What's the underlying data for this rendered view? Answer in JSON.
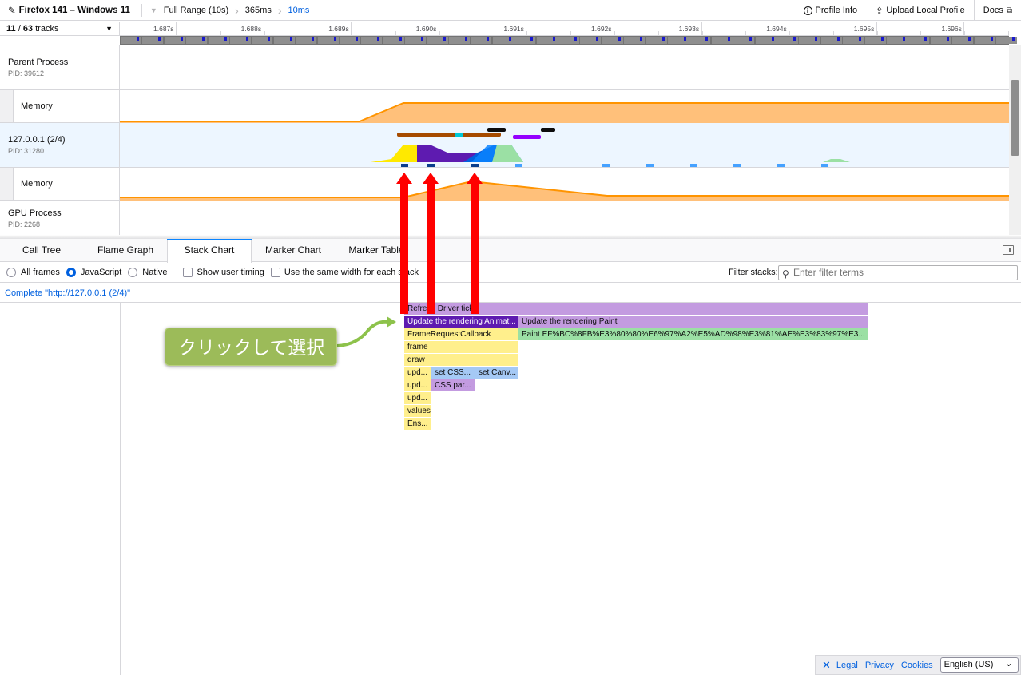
{
  "topbar": {
    "title": "Firefox 141 – Windows 11",
    "breadcrumbs": [
      "Full Range (10s)",
      "365ms",
      "10ms"
    ],
    "profile_info": "Profile Info",
    "upload": "Upload Local Profile",
    "docs": "Docs"
  },
  "timeline": {
    "track_count_visible": "11",
    "track_count_total": "63",
    "track_count_suffix": "tracks",
    "ticks": [
      "1.687s",
      "1.688s",
      "1.689s",
      "1.690s",
      "1.691s",
      "1.692s",
      "1.693s",
      "1.694s",
      "1.695s",
      "1.696s"
    ],
    "tracks": [
      {
        "name": "Parent Process",
        "pid": "PID: 39612"
      },
      {
        "name": "Memory"
      },
      {
        "name": "127.0.0.1 (2/4)",
        "pid": "PID: 31280"
      },
      {
        "name": "Memory"
      },
      {
        "name": "GPU Process",
        "pid": "PID: 2268"
      }
    ]
  },
  "tabs": [
    "Call Tree",
    "Flame Graph",
    "Stack Chart",
    "Marker Chart",
    "Marker Table"
  ],
  "selected_tab": "Stack Chart",
  "settings": {
    "all_frames": "All frames",
    "javascript": "JavaScript",
    "native": "Native",
    "show_user_timing": "Show user timing",
    "same_width": "Use the same width for each stack",
    "filter_label": "Filter stacks:",
    "filter_placeholder": "Enter filter terms"
  },
  "breadcrumb": "Complete \"http://127.0.0.1 (2/4)\"",
  "stack": {
    "refresh": "Refresh Driver tick",
    "update_anim": "Update the rendering Animat...",
    "update_paint": "Update the rendering Paint",
    "frame_request": "FrameRequestCallback",
    "paint_url": "Paint EF%BC%8FB%E3%80%80%E6%97%A2%E5%AD%98%E3%81%AE%E3%83%97%E3...",
    "frame": "frame",
    "draw": "draw",
    "upd1": "upd...",
    "set_css": "set CSS...",
    "set_canv": "set Canv...",
    "upd2": "upd...",
    "css_par": "CSS par...",
    "upd3": "upd...",
    "values": "values",
    "ens": "Ens..."
  },
  "annotation": "クリックして選択",
  "footer": {
    "legal": "Legal",
    "privacy": "Privacy",
    "cookies": "Cookies",
    "language": "English (US)"
  },
  "colors": {
    "accent": "#0a84ff",
    "memory_fill": "#ffc07a",
    "memory_line": "#ff9400",
    "js_yellow": "#ffef8c",
    "anim_purple": "#5e1bb0",
    "paint_purple": "#c39be0",
    "paint_green": "#9be0a4",
    "css_blue": "#a5c9f5",
    "arrow_red": "#ff0000",
    "annotation_green": "#9cbb59"
  }
}
